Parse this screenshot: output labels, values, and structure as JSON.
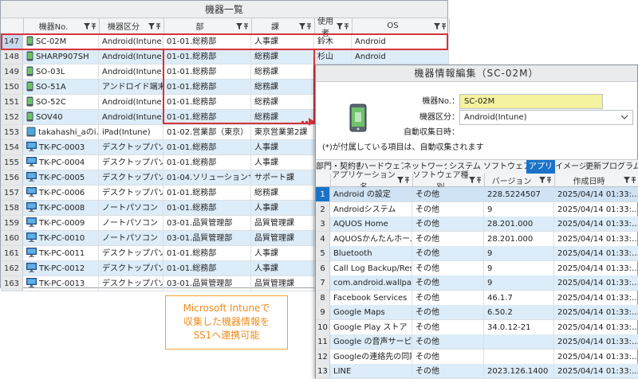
{
  "device_list": {
    "title": "機器一覧",
    "columns": [
      "機器No.",
      "機器区分",
      "部",
      "課",
      "使用者",
      "OS"
    ],
    "rows": [
      {
        "n": "147",
        "id": "SC-02M",
        "type": "Android(Intune)",
        "dept": "01-01.総務部",
        "section": "人事課",
        "user": "鈴木",
        "os": "Android",
        "icon": "phone-icon"
      },
      {
        "n": "148",
        "id": "SHARP907SH",
        "type": "Android(Intune)",
        "dept": "01-01.総務部",
        "section": "総務課",
        "user": "杉山",
        "os": "Android",
        "icon": "phone-icon"
      },
      {
        "n": "149",
        "id": "SO-03L",
        "type": "Android(Intune)",
        "dept": "01-01.総務部",
        "section": "総務課",
        "user": "",
        "os": "",
        "icon": "phone-icon"
      },
      {
        "n": "150",
        "id": "SO-51A",
        "type": "アンドロイド端末",
        "dept": "01-01.総務部",
        "section": "総務課",
        "user": "",
        "os": "",
        "icon": "phone-icon"
      },
      {
        "n": "151",
        "id": "SO-52C",
        "type": "Android(Intune)",
        "dept": "01-01.総務部",
        "section": "総務課",
        "user": "",
        "os": "",
        "icon": "phone-icon"
      },
      {
        "n": "152",
        "id": "SOV40",
        "type": "Android(Intune)",
        "dept": "01-01.総務部",
        "section": "総務課",
        "user": "",
        "os": "",
        "icon": "phone-icon"
      },
      {
        "n": "153",
        "id": "takahashi_aのi…",
        "type": "iPad(Intune)",
        "dept": "01-02.営業部（東京）",
        "section": "東京営業第2課",
        "user": "",
        "os": "",
        "icon": "tablet-icon"
      },
      {
        "n": "154",
        "id": "TK-PC-0003",
        "type": "デスクトップパソコン",
        "dept": "01-01.総務部",
        "section": "人事課",
        "user": "",
        "os": "",
        "icon": "monitor-icon"
      },
      {
        "n": "155",
        "id": "TK-PC-0004",
        "type": "デスクトップパソコン",
        "dept": "01-01.総務部",
        "section": "人事課",
        "user": "",
        "os": "",
        "icon": "monitor-icon"
      },
      {
        "n": "156",
        "id": "TK-PC-0005",
        "type": "デスクトップパソコン",
        "dept": "01-04.ソリューションサ…",
        "section": "サポート課",
        "user": "",
        "os": "",
        "icon": "monitor-icon"
      },
      {
        "n": "157",
        "id": "TK-PC-0006",
        "type": "デスクトップパソコン",
        "dept": "01-01.総務部",
        "section": "総務課",
        "user": "",
        "os": "",
        "icon": "monitor-icon"
      },
      {
        "n": "158",
        "id": "TK-PC-0008",
        "type": "ノートパソコン",
        "dept": "01-01.総務部",
        "section": "人事課",
        "user": "",
        "os": "",
        "icon": "monitor-icon"
      },
      {
        "n": "159",
        "id": "TK-PC-0009",
        "type": "ノートパソコン",
        "dept": "03-01.品質管理部",
        "section": "品質管理課",
        "user": "",
        "os": "",
        "icon": "monitor-icon"
      },
      {
        "n": "160",
        "id": "TK-PC-0010",
        "type": "ノートパソコン",
        "dept": "03-01.品質管理部",
        "section": "品質管理課",
        "user": "",
        "os": "",
        "icon": "monitor-icon"
      },
      {
        "n": "161",
        "id": "TK-PC-0011",
        "type": "デスクトップパソコン",
        "dept": "01-01.総務部",
        "section": "人事課",
        "user": "",
        "os": "",
        "icon": "monitor-icon"
      },
      {
        "n": "162",
        "id": "TK-PC-0012",
        "type": "デスクトップパソコン",
        "dept": "01-01.総務部",
        "section": "人事課",
        "user": "",
        "os": "",
        "icon": "monitor-icon"
      },
      {
        "n": "163",
        "id": "TK-PC-0013",
        "type": "デスクトップパソコン",
        "dept": "03-01.品質管理部",
        "section": "品質管理課",
        "user": "",
        "os": "",
        "icon": "monitor-icon"
      }
    ]
  },
  "edit_panel": {
    "title": "機器情報編集（SC-02M）",
    "device_no_label": "機器No.：",
    "device_no_value": "SC-02M",
    "device_type_label": "機器区分：",
    "device_type_value": "Android(Intune)",
    "auto_collect_label": "自動収集日時：",
    "required_note": "(*)が付属している項目は、自動収集されます",
    "tabs": [
      "部門・契約書",
      "ハードウェア",
      "ネットワーク",
      "システム",
      "ソフトウェア",
      "アプリ",
      "イメージ",
      "更新プログラム"
    ],
    "active_tab": "アプリ",
    "columns": [
      "アプリケーション名",
      "ソフトウェア種別",
      "バージョン",
      "作成日時"
    ],
    "apps": [
      {
        "n": "1",
        "name": "Android の設定",
        "kind": "その他",
        "ver": "228.5224507",
        "date": "2025/04/14 01:33:…"
      },
      {
        "n": "2",
        "name": "Androidシステム",
        "kind": "その他",
        "ver": "9",
        "date": "2025/04/14 01:33:…"
      },
      {
        "n": "3",
        "name": "AQUOS Home",
        "kind": "その他",
        "ver": "28.201.000",
        "date": "2025/04/14 01:33:…"
      },
      {
        "n": "4",
        "name": "AQUOSかんたんホーム",
        "kind": "その他",
        "ver": "28.201.000",
        "date": "2025/04/14 01:33:…"
      },
      {
        "n": "5",
        "name": "Bluetooth",
        "kind": "その他",
        "ver": "9",
        "date": "2025/04/14 01:33:…"
      },
      {
        "n": "6",
        "name": "Call Log Backup/Rest…",
        "kind": "その他",
        "ver": "9",
        "date": "2025/04/14 01:33:…"
      },
      {
        "n": "7",
        "name": "com.android.wallpap…",
        "kind": "その他",
        "ver": "9",
        "date": "2025/04/14 01:33:…"
      },
      {
        "n": "8",
        "name": "Facebook Services",
        "kind": "その他",
        "ver": "46.1.7",
        "date": "2025/04/14 01:33:…"
      },
      {
        "n": "9",
        "name": "Google Maps",
        "kind": "その他",
        "ver": "6.50.2",
        "date": "2025/04/14 01:33:…"
      },
      {
        "n": "10",
        "name": "Google Play ストア",
        "kind": "その他",
        "ver": "34.0.12-21",
        "date": "2025/04/14 01:33:…"
      },
      {
        "n": "11",
        "name": "Google の音声サービス",
        "kind": "その他",
        "ver": "",
        "date": "2025/04/14 01:33:…"
      },
      {
        "n": "12",
        "name": "Googleの連絡先の同期",
        "kind": "その他",
        "ver": "",
        "date": "2025/04/14 01:33:…"
      },
      {
        "n": "13",
        "name": "LINE",
        "kind": "その他",
        "ver": "2023.126.1400",
        "date": "2025/04/14 01:33:…"
      }
    ]
  },
  "callout": {
    "lines": [
      "Microsoft Intuneで",
      "収集した機器情報を",
      "SS1へ連携可能"
    ]
  },
  "colors": {
    "highlight_red": "#d6333a",
    "accent_blue": "#1a73c9",
    "callout_orange": "#f08c1a",
    "input_yellow": "#f5f2a0",
    "alt_row_blue": "#dcecf8"
  }
}
